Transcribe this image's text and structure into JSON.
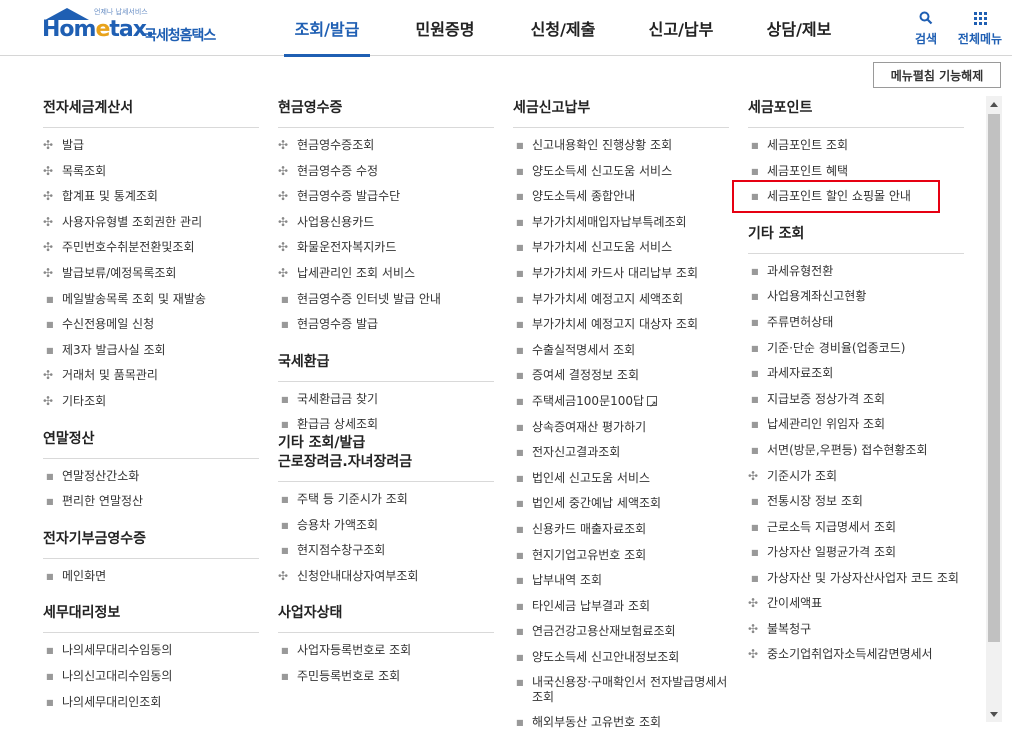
{
  "header": {
    "logo_small": "언제나 납세서비스",
    "logo_main_a": "Hom",
    "logo_main_e": "e",
    "logo_main_b": "tax.",
    "logo_ko": "국세청홈택스",
    "gnb": [
      "조회/발급",
      "민원증명",
      "신청/제출",
      "신고/납부",
      "상담/제보"
    ],
    "search_label": "검색",
    "allmenu_label": "전체메뉴"
  },
  "toggle_label": "메뉴펼침 기능해제",
  "columns": [
    {
      "sections": [
        {
          "title": "전자세금계산서",
          "items": [
            {
              "text": "발급",
              "mark": "plus"
            },
            {
              "text": "목록조회",
              "mark": "plus"
            },
            {
              "text": "합계표 및 통계조회",
              "mark": "plus"
            },
            {
              "text": "사용자유형별 조회권한 관리",
              "mark": "plus"
            },
            {
              "text": "주민번호수취분전환및조회",
              "mark": "plus"
            },
            {
              "text": "발급보류/예정목록조회",
              "mark": "plus"
            },
            {
              "text": "메일발송목록 조회 및 재발송",
              "mark": "dot"
            },
            {
              "text": "수신전용메일 신청",
              "mark": "dot"
            },
            {
              "text": "제3자 발급사실 조회",
              "mark": "dot"
            },
            {
              "text": "거래처 및 품목관리",
              "mark": "plus"
            },
            {
              "text": "기타조회",
              "mark": "plus"
            }
          ]
        },
        {
          "title": "연말정산",
          "items": [
            {
              "text": "연말정산간소화",
              "mark": "dot"
            },
            {
              "text": "편리한 연말정산",
              "mark": "dot"
            }
          ]
        },
        {
          "title": "전자기부금영수증",
          "items": [
            {
              "text": "메인화면",
              "mark": "dot"
            }
          ]
        },
        {
          "title": "세무대리정보",
          "items": [
            {
              "text": "나의세무대리수임동의",
              "mark": "dot"
            },
            {
              "text": "나의신고대리수임동의",
              "mark": "dot"
            },
            {
              "text": "나의세무대리인조회",
              "mark": "dot"
            }
          ]
        }
      ]
    },
    {
      "sections": [
        {
          "title": "현금영수증",
          "items": [
            {
              "text": "현금영수증조회",
              "mark": "plus"
            },
            {
              "text": "현금영수증 수정",
              "mark": "plus"
            },
            {
              "text": "현금영수증 발급수단",
              "mark": "plus"
            },
            {
              "text": "사업용신용카드",
              "mark": "plus"
            },
            {
              "text": "화물운전자복지카드",
              "mark": "plus"
            },
            {
              "text": "납세관리인 조회 서비스",
              "mark": "plus"
            },
            {
              "text": "현금영수증 인터넷 발급 안내",
              "mark": "dot"
            },
            {
              "text": "현금영수증 발급",
              "mark": "dot"
            }
          ]
        },
        {
          "title": "국세환급",
          "items": [
            {
              "text": "국세환급금 찾기",
              "mark": "dot"
            },
            {
              "text": "환급금 상세조회",
              "mark": "dot"
            }
          ]
        },
        {
          "title": "근로장려금.자녀장려금",
          "items": [
            {
              "text": "주택 등 기준시가 조회",
              "mark": "dot"
            },
            {
              "text": "승용차 가액조회",
              "mark": "dot"
            },
            {
              "text": "현지점수창구조회",
              "mark": "dot"
            },
            {
              "text": "신청안내대상자여부조회",
              "mark": "plus"
            }
          ]
        },
        {
          "title": "사업자상태",
          "items": [
            {
              "text": "사업자등록번호로 조회",
              "mark": "dot"
            },
            {
              "text": "주민등록번호로 조회",
              "mark": "dot"
            }
          ]
        }
      ],
      "floating_title": "기타 조회/발급"
    },
    {
      "sections": [
        {
          "title": "세금신고납부",
          "items": [
            {
              "text": "신고내용확인 진행상황 조회",
              "mark": "dot"
            },
            {
              "text": "양도소득세 신고도움 서비스",
              "mark": "dot"
            },
            {
              "text": "양도소득세 종합안내",
              "mark": "dot"
            },
            {
              "text": "부가가치세매입자납부특례조회",
              "mark": "dot"
            },
            {
              "text": "부가가치세 신고도움 서비스",
              "mark": "dot"
            },
            {
              "text": "부가가치세 카드사 대리납부 조회",
              "mark": "dot"
            },
            {
              "text": "부가가치세 예정고지 세액조회",
              "mark": "dot"
            },
            {
              "text": "부가가치세 예정고지 대상자 조회",
              "mark": "dot"
            },
            {
              "text": "수출실적명세서 조회",
              "mark": "dot"
            },
            {
              "text": "증여세 결정정보 조회",
              "mark": "dot"
            },
            {
              "text": "주택세금100문100답",
              "mark": "dot",
              "ext": true
            },
            {
              "text": "상속증여재산 평가하기",
              "mark": "dot"
            },
            {
              "text": "전자신고결과조회",
              "mark": "dot"
            },
            {
              "text": "법인세 신고도움 서비스",
              "mark": "dot"
            },
            {
              "text": "법인세 중간예납 세액조회",
              "mark": "dot"
            },
            {
              "text": "신용카드 매출자료조회",
              "mark": "dot"
            },
            {
              "text": "현지기업고유번호 조회",
              "mark": "dot"
            },
            {
              "text": "납부내역 조회",
              "mark": "dot"
            },
            {
              "text": "타인세금 납부결과 조회",
              "mark": "dot"
            },
            {
              "text": "연금건강고용산재보험료조회",
              "mark": "dot"
            },
            {
              "text": "양도소득세 신고안내정보조회",
              "mark": "dot"
            },
            {
              "text": "내국신용장·구매확인서 전자발급명세서 조회",
              "mark": "dot",
              "wrap": true
            },
            {
              "text": "해외부동산 고유번호 조회",
              "mark": "dot"
            }
          ]
        }
      ]
    },
    {
      "sections": [
        {
          "title": "세금포인트",
          "items": [
            {
              "text": "세금포인트 조회",
              "mark": "dot"
            },
            {
              "text": "세금포인트 혜택",
              "mark": "dot"
            },
            {
              "text": "세금포인트 할인 쇼핑몰 안내",
              "mark": "dot"
            }
          ]
        },
        {
          "title": "기타 조회",
          "items": [
            {
              "text": "과세유형전환",
              "mark": "dot"
            },
            {
              "text": "사업용계좌신고현황",
              "mark": "dot"
            },
            {
              "text": "주류면허상태",
              "mark": "dot"
            },
            {
              "text": "기준·단순 경비율(업종코드)",
              "mark": "dot"
            },
            {
              "text": "과세자료조회",
              "mark": "dot"
            },
            {
              "text": "지급보증 정상가격 조회",
              "mark": "dot"
            },
            {
              "text": "납세관리인 위임자 조회",
              "mark": "dot"
            },
            {
              "text": "서면(방문,우편등) 접수현황조회",
              "mark": "dot"
            },
            {
              "text": "기준시가 조회",
              "mark": "plus"
            },
            {
              "text": "전통시장 정보 조회",
              "mark": "dot"
            },
            {
              "text": "근로소득 지급명세서 조회",
              "mark": "dot"
            },
            {
              "text": "가상자산 일평균가격 조회",
              "mark": "dot"
            },
            {
              "text": "가상자산 및 가상자산사업자 코드 조회",
              "mark": "dot",
              "wrap": true
            },
            {
              "text": "간이세액표",
              "mark": "plus"
            },
            {
              "text": "불복청구",
              "mark": "plus"
            },
            {
              "text": "중소기업취업자소득세감면명세서",
              "mark": "plus"
            }
          ]
        }
      ]
    }
  ],
  "accent_color": "#1f5fb3",
  "highlight_color": "#e60012"
}
